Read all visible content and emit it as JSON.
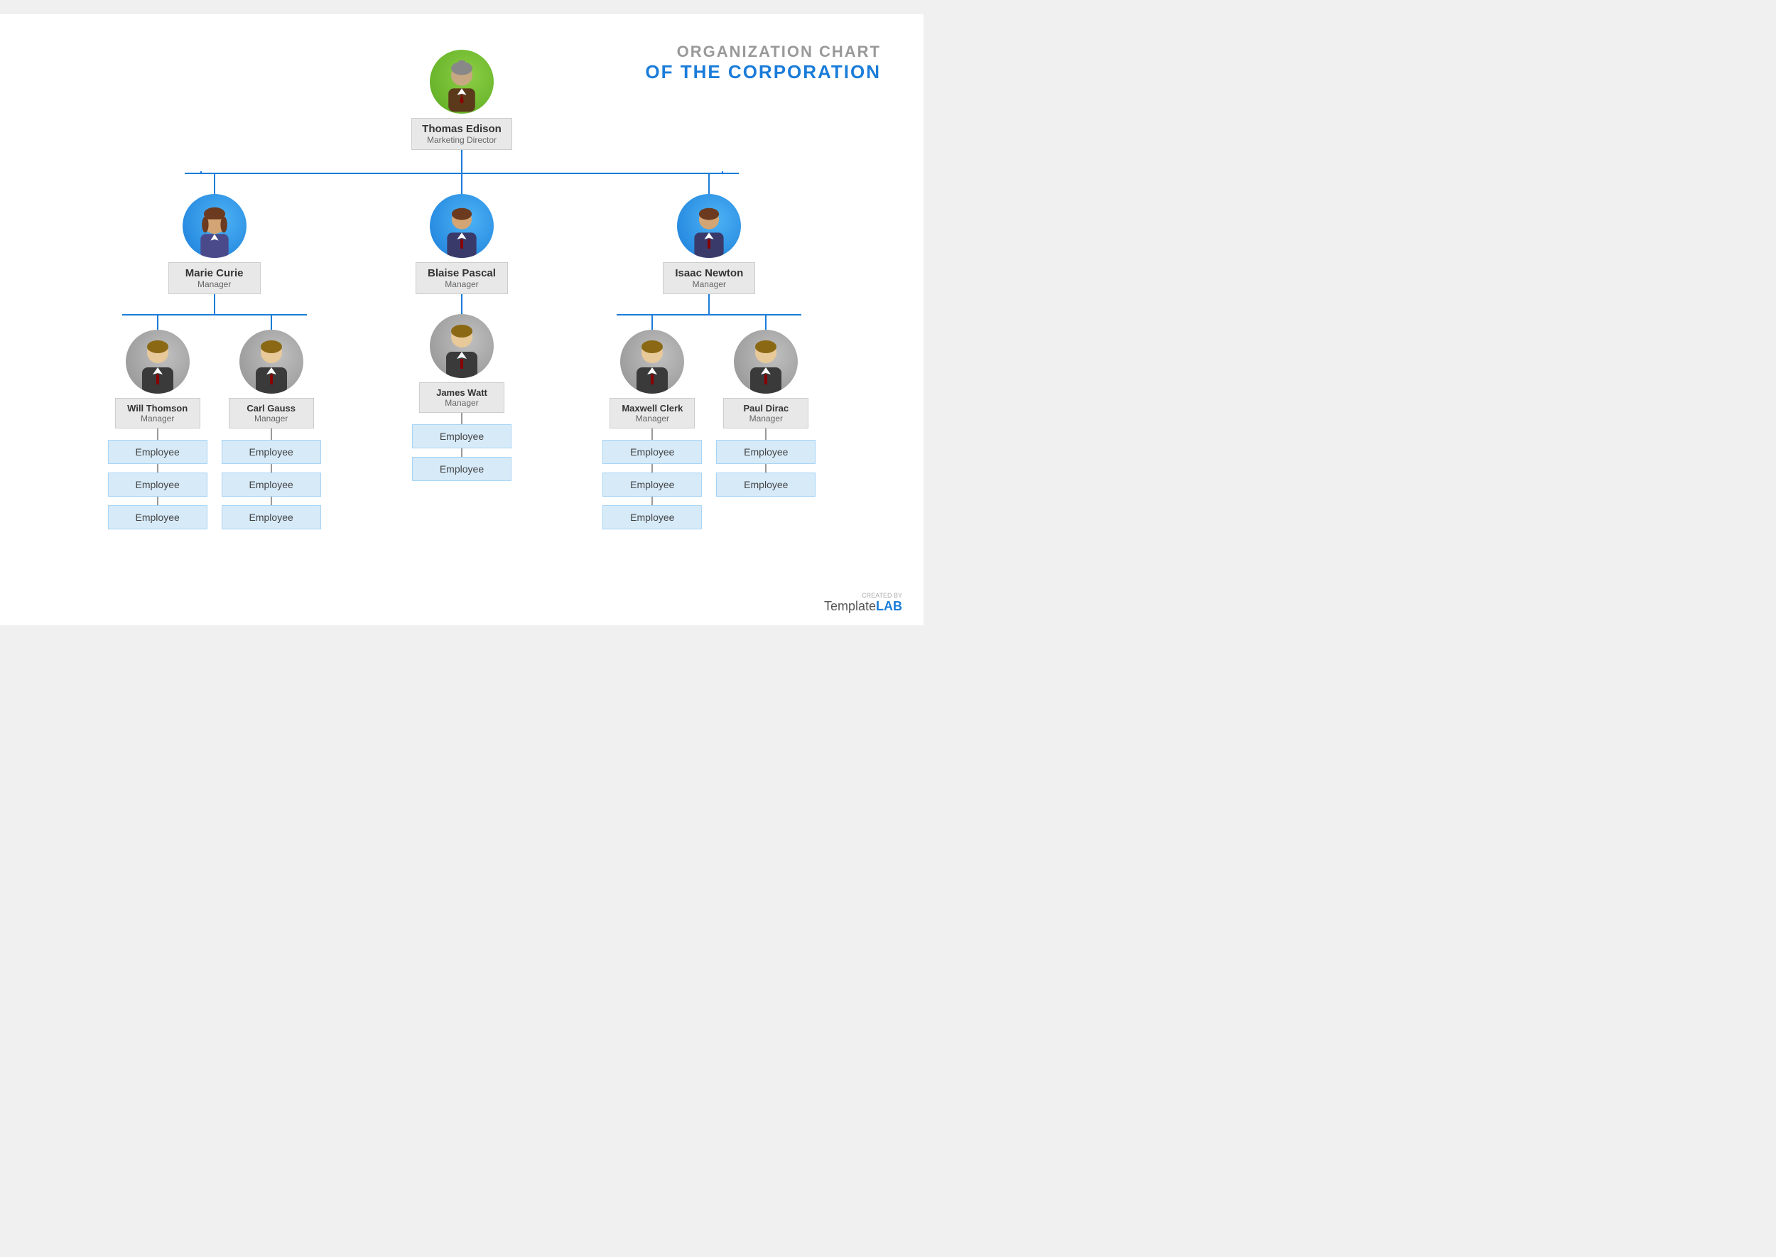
{
  "title": {
    "line1": "ORGANIZATION CHART",
    "line2": "OF THE CORPORATION"
  },
  "watermark": {
    "created_by": "CREATED BY",
    "brand_template": "Template",
    "brand_lab": "LAB"
  },
  "ceo": {
    "name": "Thomas Edison",
    "role": "Marketing Director",
    "avatar_style": "green"
  },
  "managers": [
    {
      "name": "Marie Curie",
      "role": "Manager",
      "avatar_style": "blue",
      "gender": "female",
      "sub_managers": [
        {
          "name": "Will Thomson",
          "role": "Manager",
          "avatar_style": "gray",
          "employees": [
            "Employee",
            "Employee",
            "Employee"
          ]
        },
        {
          "name": "Carl Gauss",
          "role": "Manager",
          "avatar_style": "gray",
          "employees": [
            "Employee",
            "Employee",
            "Employee"
          ]
        }
      ]
    },
    {
      "name": "Blaise Pascal",
      "role": "Manager",
      "avatar_style": "blue",
      "gender": "male",
      "sub_managers": [
        {
          "name": "James Watt",
          "role": "Manager",
          "avatar_style": "gray",
          "employees": [
            "Employee",
            "Employee"
          ]
        }
      ]
    },
    {
      "name": "Isaac Newton",
      "role": "Manager",
      "avatar_style": "blue",
      "gender": "male",
      "sub_managers": [
        {
          "name": "Maxwell Clerk",
          "role": "Manager",
          "avatar_style": "gray",
          "employees": [
            "Employee",
            "Employee",
            "Employee"
          ]
        },
        {
          "name": "Paul Dirac",
          "role": "Manager",
          "avatar_style": "gray",
          "employees": [
            "Employee",
            "Employee"
          ]
        }
      ]
    }
  ]
}
